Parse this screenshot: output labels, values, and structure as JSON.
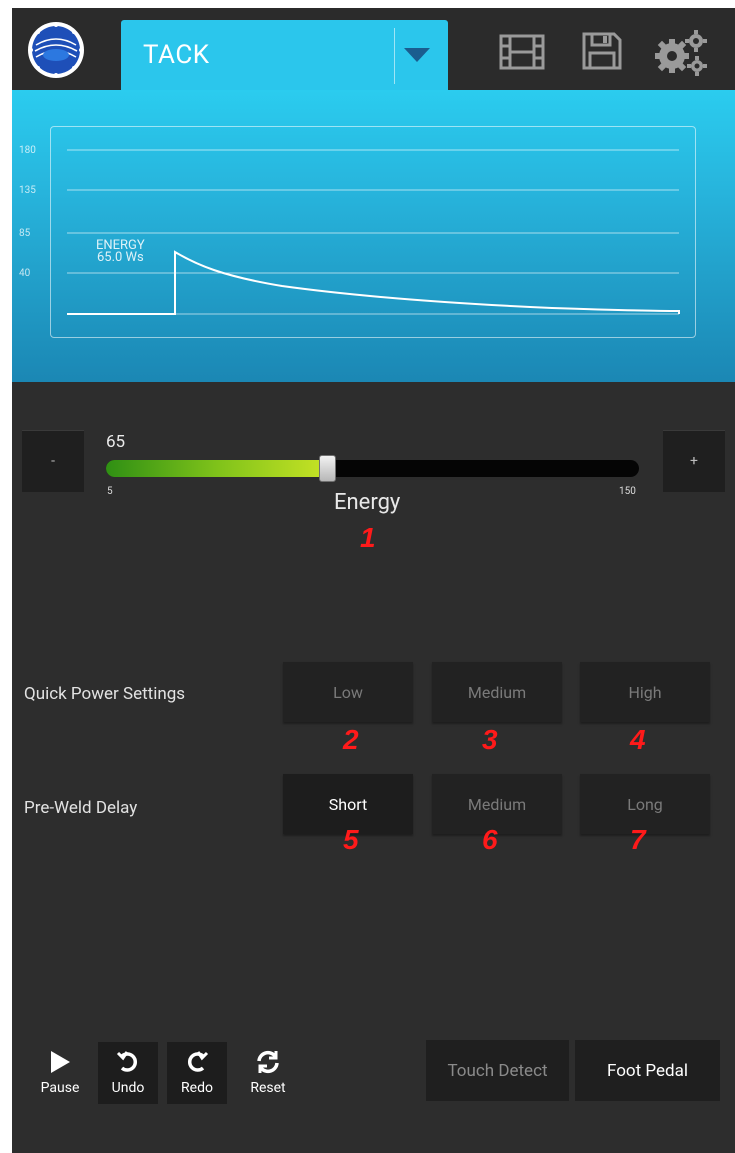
{
  "header": {
    "mode": "TACK",
    "icons": [
      "logo-icon",
      "dropdown-arrow-icon",
      "film-icon",
      "save-icon",
      "settings-gears-icon"
    ]
  },
  "chart_data": {
    "type": "line",
    "y_ticks": [
      "180",
      "135",
      "85",
      "40"
    ],
    "annotation": {
      "label": "ENERGY",
      "value": "65.0 Ws"
    },
    "colors": {
      "line": "#ffffff",
      "background_top": "#2bccef",
      "background_bottom": "#1b87b4"
    }
  },
  "slider": {
    "minus_label": "-",
    "plus_label": "+",
    "value": "65",
    "min": "5",
    "max": "150",
    "fraction": 0.4138,
    "label": "Energy",
    "colors": {
      "fill_start": "#2f8f14",
      "fill_end": "#c7e325",
      "track": "#050505"
    }
  },
  "callouts": [
    "1",
    "2",
    "3",
    "4",
    "5",
    "6",
    "7"
  ],
  "quick_power": {
    "label": "Quick Power Settings",
    "options": [
      "Low",
      "Medium",
      "High"
    ]
  },
  "pre_weld": {
    "label": "Pre-Weld Delay",
    "options": [
      "Short",
      "Medium",
      "Long"
    ],
    "selected": "Short"
  },
  "controls": {
    "pause": "Pause",
    "undo": "Undo",
    "redo": "Redo",
    "reset": "Reset"
  },
  "bottom_buttons": {
    "touch_detect": "Touch Detect",
    "foot_pedal": "Foot Pedal"
  }
}
